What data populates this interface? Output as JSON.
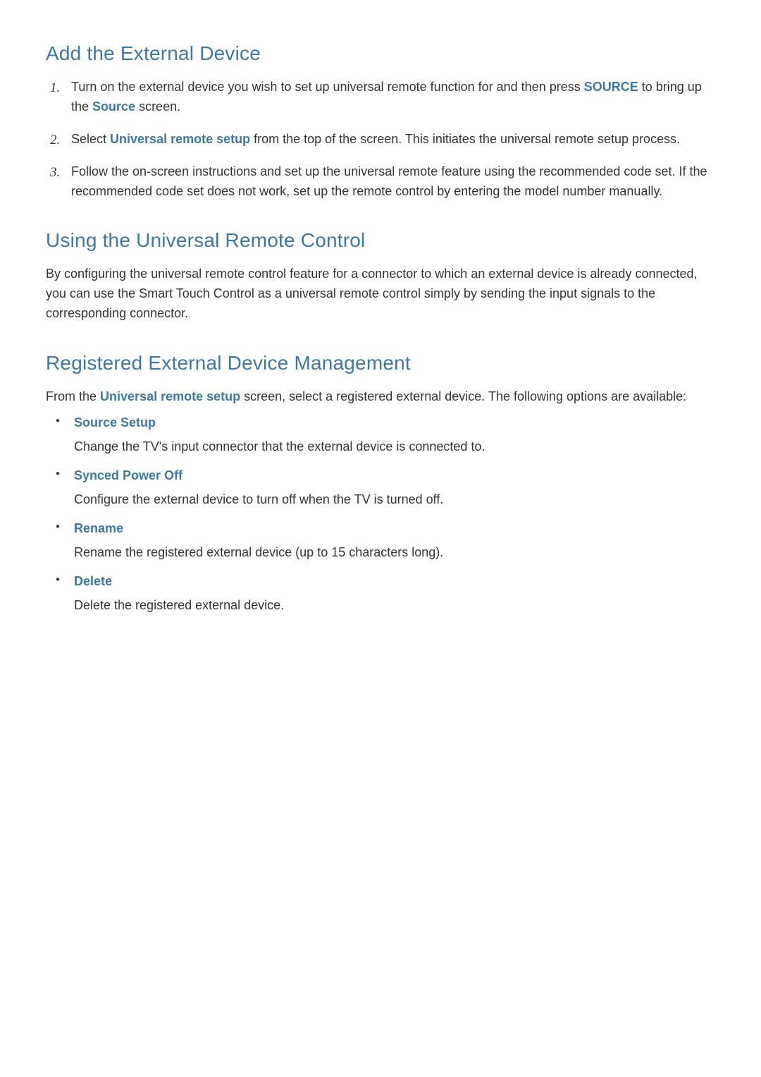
{
  "section1": {
    "heading": "Add the External Device",
    "steps": {
      "s1_pre": "Turn on the external device you wish to set up universal remote function for and then press ",
      "s1_kw1": "SOURCE",
      "s1_mid": " to bring up the ",
      "s1_kw2": "Source",
      "s1_post": " screen.",
      "s2_pre": "Select ",
      "s2_kw": "Universal remote setup",
      "s2_post": " from the top of the screen. This initiates the universal remote setup process.",
      "s3": "Follow the on-screen instructions and set up the universal remote feature using the recommended code set. If the recommended code set does not work, set up the remote control by entering the model number manually."
    }
  },
  "section2": {
    "heading": "Using the Universal Remote Control",
    "para": "By configuring the universal remote control feature for a connector to which an external device is already connected, you can use the Smart Touch Control as a universal remote control simply by sending the input signals to the corresponding connector."
  },
  "section3": {
    "heading": "Registered External Device Management",
    "intro_pre": "From the ",
    "intro_kw": "Universal remote setup",
    "intro_post": " screen, select a registered external device. The following options are available:",
    "options": {
      "o1_title": "Source Setup",
      "o1_desc": "Change the TV's input connector that the external device is connected to.",
      "o2_title": "Synced Power Off",
      "o2_desc": "Configure the external device to turn off when the TV is turned off.",
      "o3_title": "Rename",
      "o3_desc": "Rename the registered external device (up to 15 characters long).",
      "o4_title": "Delete",
      "o4_desc": "Delete the registered external device."
    }
  }
}
